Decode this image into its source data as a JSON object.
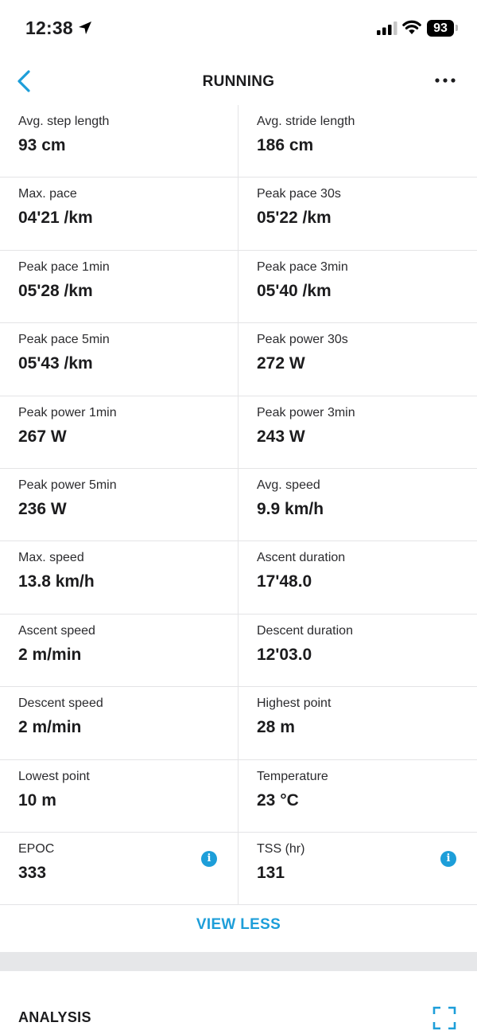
{
  "status_bar": {
    "time": "12:38",
    "battery": "93",
    "icons": [
      "location-arrow-icon",
      "cellular-signal-icon",
      "wifi-icon",
      "battery-icon"
    ]
  },
  "nav": {
    "title": "RUNNING",
    "back_icon": "chevron-left-icon",
    "more_icon": "ellipsis-icon"
  },
  "stats": [
    {
      "label": "Avg. step length",
      "value": "93 cm"
    },
    {
      "label": "Avg. stride length",
      "value": "186 cm"
    },
    {
      "label": "Max. pace",
      "value": "04'21 /km"
    },
    {
      "label": "Peak pace 30s",
      "value": "05'22 /km"
    },
    {
      "label": "Peak pace 1min",
      "value": "05'28 /km"
    },
    {
      "label": "Peak pace 3min",
      "value": "05'40 /km"
    },
    {
      "label": "Peak pace 5min",
      "value": "05'43 /km"
    },
    {
      "label": "Peak power 30s",
      "value": "272 W"
    },
    {
      "label": "Peak power 1min",
      "value": "267 W"
    },
    {
      "label": "Peak power 3min",
      "value": "243 W"
    },
    {
      "label": "Peak power 5min",
      "value": "236 W"
    },
    {
      "label": "Avg. speed",
      "value": "9.9 km/h"
    },
    {
      "label": "Max. speed",
      "value": "13.8 km/h"
    },
    {
      "label": "Ascent duration",
      "value": "17'48.0"
    },
    {
      "label": "Ascent speed",
      "value": "2 m/min"
    },
    {
      "label": "Descent duration",
      "value": "12'03.0"
    },
    {
      "label": "Descent speed",
      "value": "2 m/min"
    },
    {
      "label": "Highest point",
      "value": "28 m"
    },
    {
      "label": "Lowest point",
      "value": "10 m"
    },
    {
      "label": "Temperature",
      "value": "23 °C"
    },
    {
      "label": "EPOC",
      "value": "333",
      "info": "i"
    },
    {
      "label": "TSS (hr)",
      "value": "131",
      "info": "i"
    }
  ],
  "view_less_label": "VIEW LESS",
  "analysis": {
    "title": "ANALYSIS",
    "expand_icon": "expand-icon"
  },
  "colors": {
    "accent": "#1d9ed9",
    "divider": "#e4e4e6",
    "section_gap": "#e6e7e9",
    "text": "#1c1c1e"
  }
}
